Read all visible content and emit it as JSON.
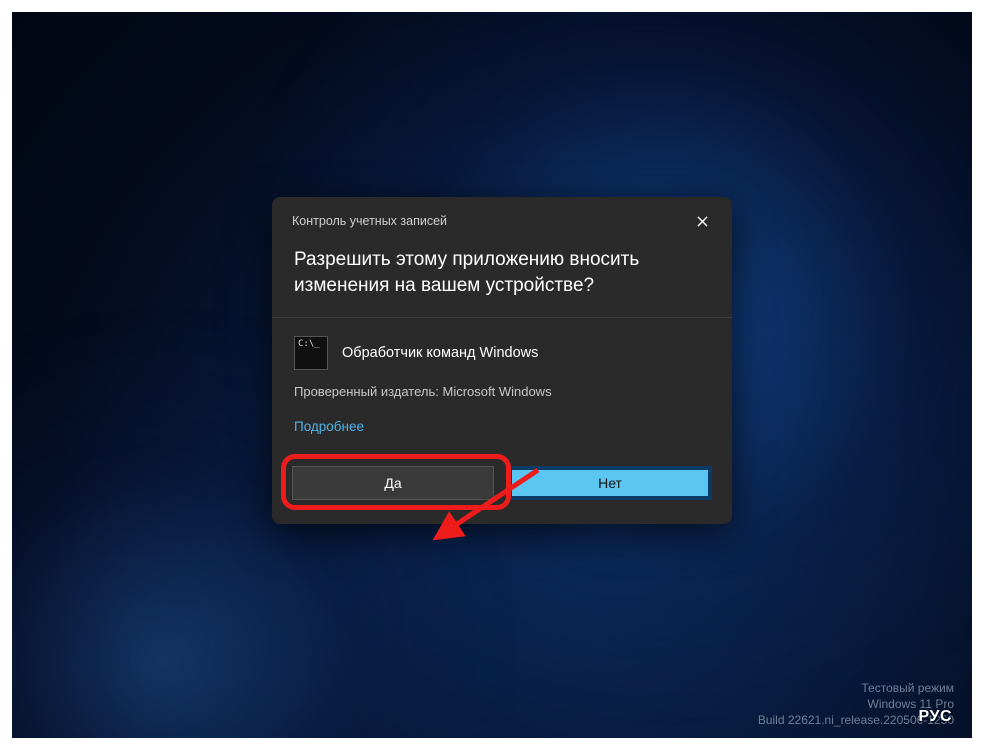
{
  "uac": {
    "header_title": "Контроль учетных записей",
    "question": "Разрешить этому приложению вносить изменения на вашем устройстве?",
    "app_name": "Обработчик команд Windows",
    "publisher": "Проверенный издатель: Microsoft Windows",
    "more_link": "Подробнее",
    "yes_label": "Да",
    "no_label": "Нет"
  },
  "watermark": {
    "line1": "Тестовый режим",
    "line2": "Windows 11 Pro",
    "line3": "Build 22621.ni_release.220506-1250"
  },
  "lang_indicator": "РУС",
  "colors": {
    "dialog_bg": "#2a2a2a",
    "accent_blue": "#5bc6f2",
    "link": "#4fb3e8",
    "highlight": "#ef1c1c"
  }
}
